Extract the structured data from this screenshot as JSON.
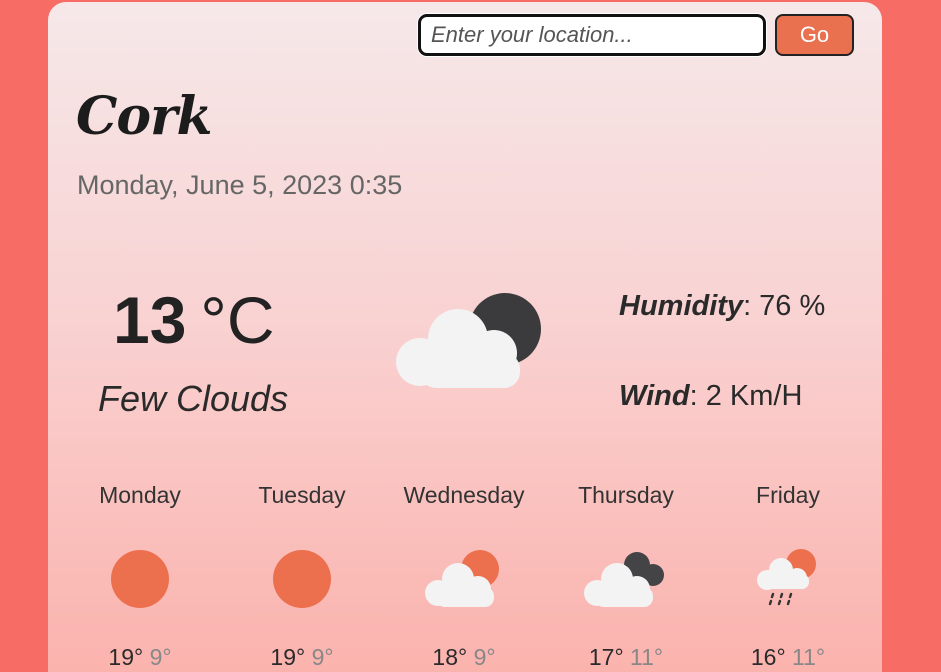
{
  "search": {
    "placeholder": "Enter your location...",
    "button_label": "Go"
  },
  "city": "Cork",
  "datetime": "Monday, June 5, 2023 0:35",
  "current": {
    "temperature": "13",
    "unit": "°C",
    "description": "Few Clouds",
    "icon": "few-clouds-night-icon",
    "humidity_label": "Humidity",
    "humidity_value": ": 76 %",
    "wind_label": "Wind",
    "wind_value": ": 2 Km/H"
  },
  "forecast": [
    {
      "day": "Monday",
      "icon": "sun-icon",
      "high": "19°",
      "low": "9°"
    },
    {
      "day": "Tuesday",
      "icon": "sun-icon",
      "high": "19°",
      "low": "9°"
    },
    {
      "day": "Wednesday",
      "icon": "cloud-sun-icon",
      "high": "18°",
      "low": "9°"
    },
    {
      "day": "Thursday",
      "icon": "dark-clouds-icon",
      "high": "17°",
      "low": "11°"
    },
    {
      "day": "Friday",
      "icon": "rain-sun-icon",
      "high": "16°",
      "low": "11°"
    }
  ],
  "colors": {
    "accent": "#e97150",
    "background": "#f76d66",
    "sun": "#ec6f4e"
  }
}
